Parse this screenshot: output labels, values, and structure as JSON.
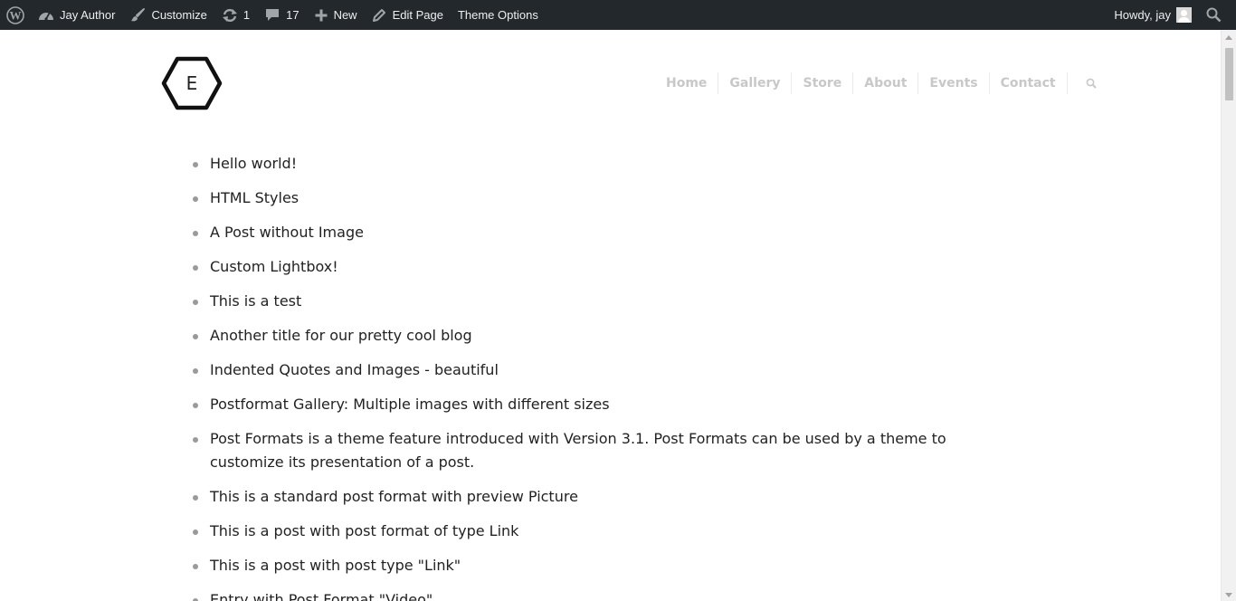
{
  "admin_bar": {
    "site_name": "Jay Author",
    "customize": "Customize",
    "updates_count": "1",
    "comments_count": "17",
    "new_label": "New",
    "edit_page": "Edit Page",
    "theme_options": "Theme Options",
    "howdy": "Howdy, jay"
  },
  "header": {
    "logo_letter": "E",
    "nav": [
      "Home",
      "Gallery",
      "Store",
      "About",
      "Events",
      "Contact"
    ]
  },
  "posts": [
    "Hello world!",
    "HTML Styles",
    "A Post without Image",
    "Custom Lightbox!",
    "This is a test",
    "Another title for our pretty cool blog",
    "Indented Quotes and Images - beautiful",
    "Postformat Gallery: Multiple images with different sizes",
    "Post Formats is a theme feature introduced with Version 3.1. Post Formats can be used by a theme to customize its presentation of a post.",
    "This is a standard post format with preview Picture",
    "This is a post with post format of type Link",
    "This is a post with post type \"Link\"",
    "Entry with Post Format \"Video\""
  ],
  "colors": {
    "admin_bar_bg": "#23282d",
    "nav_text": "#c8c8c8",
    "body_text": "#222222"
  },
  "icons": {
    "wordpress": "wordpress-logo-icon",
    "dashboard": "dashboard-icon",
    "customize": "paintbrush-icon",
    "updates": "updates-icon",
    "comments": "comment-bubble-icon",
    "new": "plus-icon",
    "edit": "pencil-icon",
    "search": "search-icon"
  }
}
